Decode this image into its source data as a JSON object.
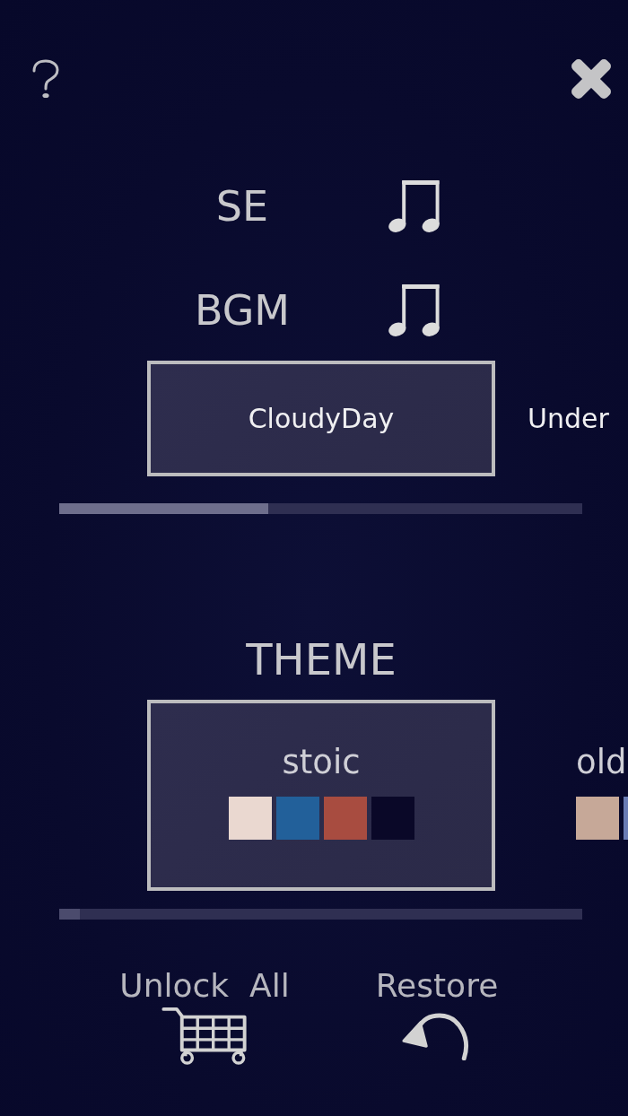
{
  "sound": [
    {
      "label": "SE",
      "on": true
    },
    {
      "label": "BGM",
      "on": true
    }
  ],
  "bgm": {
    "items": [
      {
        "title": "CloudyDay",
        "selected": true
      },
      {
        "title": "Under",
        "selected": false
      }
    ],
    "level": 0.4
  },
  "theme": {
    "title": "THEME",
    "items": [
      {
        "name": "stoic",
        "selected": true,
        "swatches": [
          {
            "color": "#ead8d0"
          },
          {
            "color": "#22609a"
          },
          {
            "color": "#a84c40"
          },
          {
            "color": "#0a0828"
          }
        ]
      },
      {
        "name": "old",
        "selected": false,
        "swatches": [
          {
            "color": "#c6a898"
          },
          {
            "color": "#6a7cb4"
          }
        ]
      }
    ],
    "level": 0.04
  },
  "buttons": [
    {
      "kind": "unlock",
      "label": "Unlock  All"
    },
    {
      "kind": "restore",
      "label": "Restore"
    }
  ]
}
